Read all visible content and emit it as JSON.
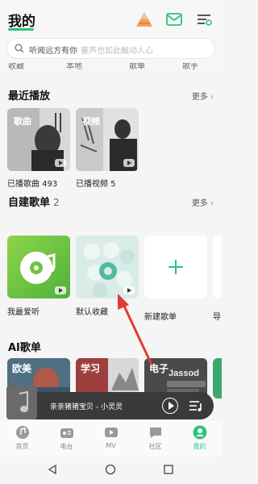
{
  "header": {
    "title": "我的"
  },
  "search": {
    "query": "听闻远方有你",
    "hint": "童声也如此触动人心"
  },
  "cut_row": [
    "收藏",
    "本地",
    "歌单",
    "歌手"
  ],
  "recent": {
    "title": "最近播放",
    "more": "更多",
    "items": [
      {
        "caption": "已播歌曲 493",
        "tile_label": "歌曲"
      },
      {
        "caption": "已播视频 5",
        "tile_label": "视频"
      }
    ]
  },
  "playlists": {
    "title": "自建歌单",
    "count": "2",
    "more": "更多",
    "items": [
      {
        "caption": "我最爱听"
      },
      {
        "caption": "默认收藏"
      },
      {
        "caption": "新建歌单"
      },
      {
        "caption": "导"
      }
    ]
  },
  "ai": {
    "title": "AI歌单",
    "items": [
      {
        "label": "欧美"
      },
      {
        "label": "学习"
      },
      {
        "label": "电子"
      },
      {
        "label": ""
      }
    ]
  },
  "mini_player": {
    "title": "亲亲猪猪宝贝 - 小灵灵"
  },
  "bottom_nav": {
    "items": [
      {
        "label": "首页"
      },
      {
        "label": "电台"
      },
      {
        "label": "MV"
      },
      {
        "label": "社区"
      },
      {
        "label": "我的"
      }
    ]
  },
  "colors": {
    "accent": "#2ec27e",
    "player": "#3a3a3a",
    "annotation": "#e53935"
  }
}
